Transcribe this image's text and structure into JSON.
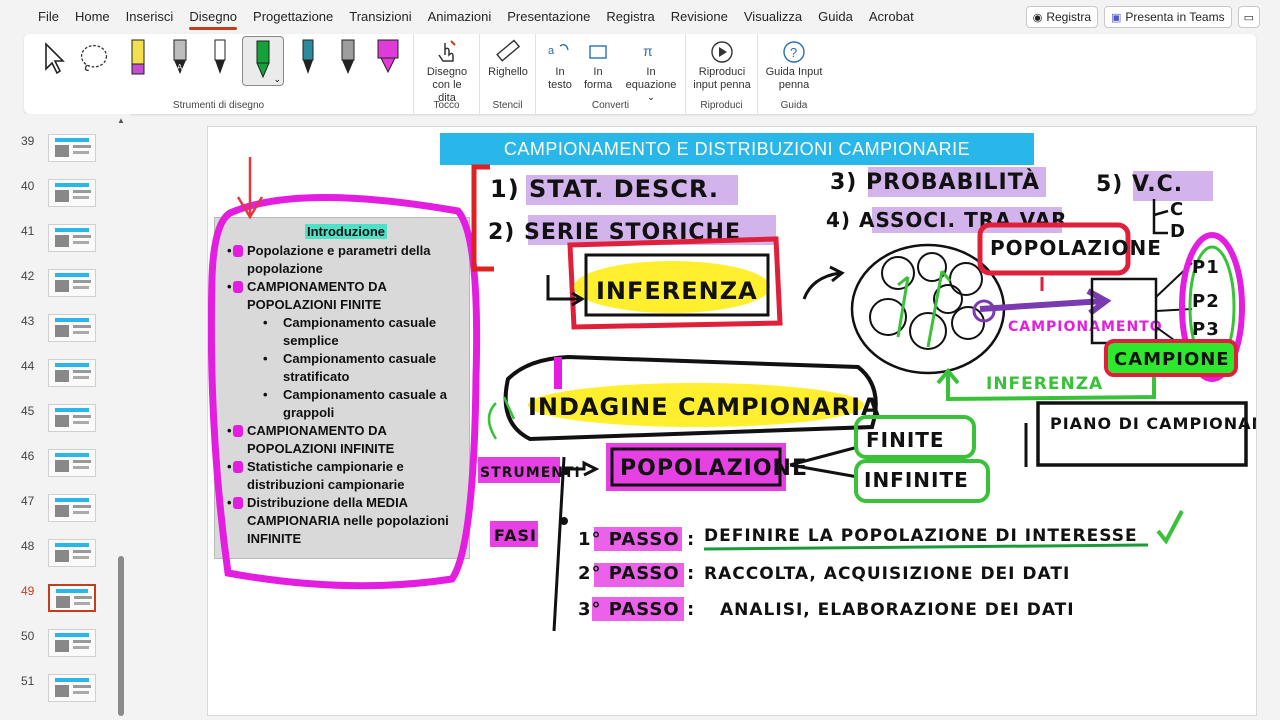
{
  "menubar": {
    "tabs": [
      "File",
      "Home",
      "Inserisci",
      "Disegno",
      "Progettazione",
      "Transizioni",
      "Animazioni",
      "Presentazione",
      "Registra",
      "Revisione",
      "Visualizza",
      "Guida",
      "Acrobat"
    ],
    "active_tab": "Disegno",
    "record_button": "Registra",
    "teams_button": "Presenta in Teams"
  },
  "ribbon": {
    "groups": {
      "drawing_tools": "Strumenti di disegno",
      "touch": "Tocco",
      "stencil": "Stencil",
      "convert": "Converti",
      "replay": "Riproduci",
      "help": "Guida"
    },
    "tools": {
      "draw_with_touch": "Disegno con le dita",
      "ruler": "Righello",
      "to_text": "In testo",
      "to_shape": "In forma",
      "to_equation": "In equazione",
      "replay_ink": "Riproduci input penna",
      "ink_guide": "Guida Input penna"
    },
    "accent": "#c43e1c"
  },
  "thumbnails": [
    {
      "num": "39"
    },
    {
      "num": "40"
    },
    {
      "num": "41"
    },
    {
      "num": "42"
    },
    {
      "num": "43"
    },
    {
      "num": "44"
    },
    {
      "num": "45"
    },
    {
      "num": "46"
    },
    {
      "num": "47"
    },
    {
      "num": "48"
    },
    {
      "num": "49",
      "active": true
    },
    {
      "num": "50"
    },
    {
      "num": "51"
    }
  ],
  "slide": {
    "title": "CAMPIONAMENTO E DISTRIBUZIONI CAMPIONARIE",
    "title_color": "#29b6e8",
    "intro_title": "Introduzione",
    "intro_items": [
      {
        "text": "Popolazione e parametri della popolazione",
        "level": 1
      },
      {
        "text": "CAMPIONAMENTO DA POPOLAZIONI FINITE",
        "level": 1
      },
      {
        "text": "Campionamento casuale semplice",
        "level": 2
      },
      {
        "text": "Campionamento casuale stratificato",
        "level": 2
      },
      {
        "text": "Campionamento casuale a grappoli",
        "level": 2
      },
      {
        "text": "CAMPIONAMENTO DA POPOLAZIONI INFINITE",
        "level": 1
      },
      {
        "text": "Statistiche campionarie e distribuzioni campionarie",
        "level": 1
      },
      {
        "text": "Distribuzione della MEDIA CAMPIONARIA nelle popolazioni INFINITE",
        "level": 1
      }
    ],
    "handwriting": {
      "stat_descr": "1) STAT. DESCR.",
      "serie": "2) SERIE STORICHE",
      "prob": "3) PROBABILITÀ",
      "assoc": "4) ASSOCI. TRA VAR.",
      "vc": "5) V.C.",
      "c": "C",
      "d": "D",
      "inferenza": "INFERENZA",
      "popolazione_top": "POPOLAZIONE",
      "p1": "P1",
      "p2": "P2",
      "p3": "P3",
      "campionamento": "CAMPIONAMENTO",
      "campione": "CAMPIONE",
      "inferenza_green": "INFERENZA",
      "indagine": "INDAGINE CAMPIONARIA",
      "piano": "PIANO DI CAMPIONAMENTO",
      "strumenti": "STRUMENTI",
      "popolazione": "POPOLAZIONE",
      "finite": "FINITE",
      "infinite": "INFINITE",
      "fasi": "FASI",
      "passo1_label": "1° PASSO :",
      "passo1_text": "DEFINIRE LA POPOLAZIONE DI INTERESSE",
      "passo2_label": "2° PASSO :",
      "passo2_text": "RACCOLTA, ACQUISIZIONE DEI DATI",
      "passo3_label": "3° PASSO :",
      "passo3_text": "ANALISI, ELABORAZIONE DEI DATI"
    }
  }
}
